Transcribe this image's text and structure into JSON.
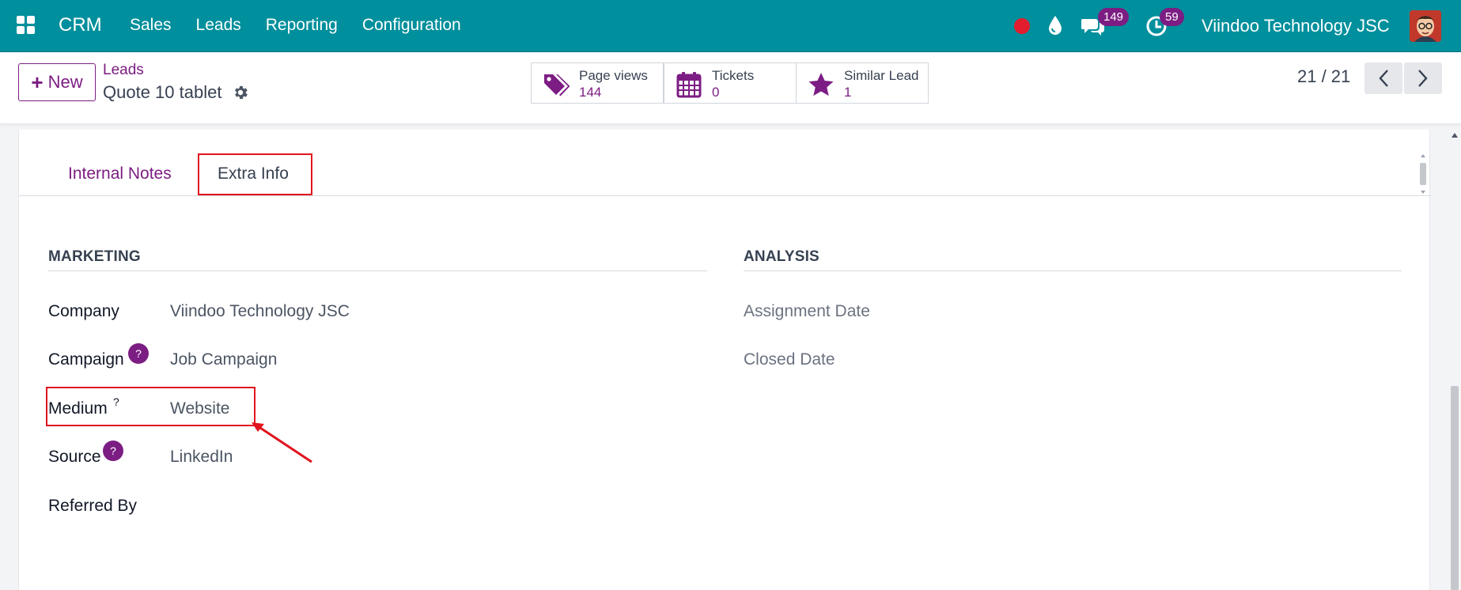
{
  "navbar": {
    "brand": "CRM",
    "menu": [
      "Sales",
      "Leads",
      "Reporting",
      "Configuration"
    ],
    "messages_count": "149",
    "activities_count": "59",
    "company": "Viindoo Technology JSC",
    "bg_color": "#008f9c"
  },
  "control": {
    "new_label": "New",
    "breadcrumb_parent": "Leads",
    "record_title": "Quote 10 tablet",
    "stats": [
      {
        "label": "Page views",
        "value": "144",
        "icon": "tags-icon"
      },
      {
        "label": "Tickets",
        "value": "0",
        "icon": "calendar-icon"
      },
      {
        "label": "Similar Lead",
        "value": "1",
        "icon": "star-icon"
      }
    ],
    "pager": "21 / 21"
  },
  "tabs": [
    {
      "label": "Internal Notes",
      "active": false
    },
    {
      "label": "Extra Info",
      "active": true
    }
  ],
  "marketing": {
    "title": "MARKETING",
    "fields": [
      {
        "label": "Company",
        "value": "Viindoo Technology JSC"
      },
      {
        "label": "Campaign",
        "value": "Job Campaign",
        "help": "?"
      },
      {
        "label": "Medium",
        "value": "Website",
        "help": "?"
      },
      {
        "label": "Source",
        "value": "LinkedIn",
        "help": "?"
      },
      {
        "label": "Referred By",
        "value": ""
      }
    ]
  },
  "analysis": {
    "title": "ANALYSIS",
    "fields": [
      "Assignment Date",
      "Closed Date"
    ]
  },
  "colors": {
    "accent": "#7c1d83",
    "highlight": "#e0141e"
  }
}
